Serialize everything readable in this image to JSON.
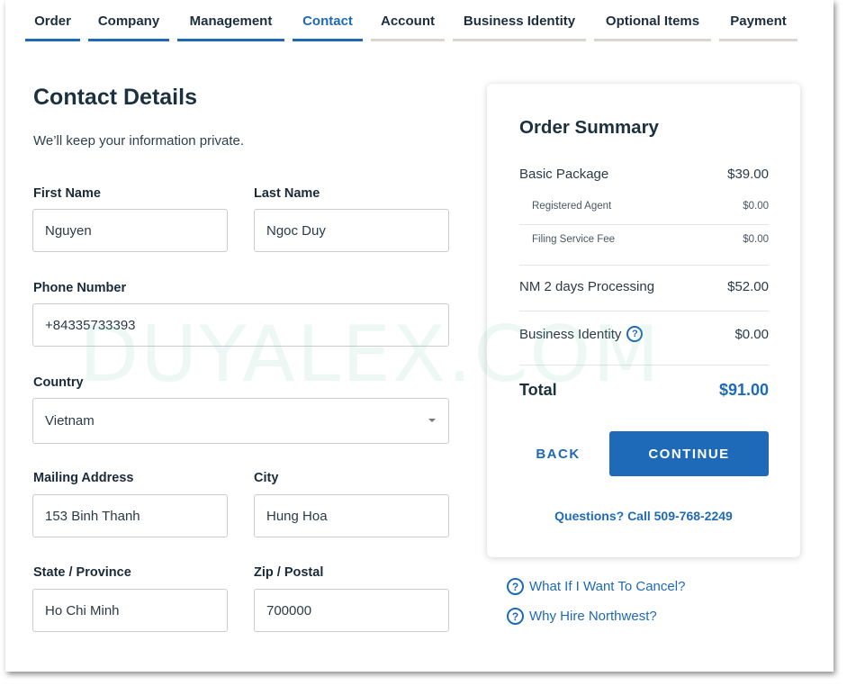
{
  "tabs": [
    {
      "label": "Order",
      "state": "done"
    },
    {
      "label": "Company",
      "state": "done"
    },
    {
      "label": "Management",
      "state": "done"
    },
    {
      "label": "Contact",
      "state": "active"
    },
    {
      "label": "Account",
      "state": "pending"
    },
    {
      "label": "Business Identity",
      "state": "pending"
    },
    {
      "label": "Optional Items",
      "state": "pending"
    },
    {
      "label": "Payment",
      "state": "pending"
    }
  ],
  "form": {
    "title": "Contact Details",
    "subtitle": "We’ll keep your information private.",
    "first_name": {
      "label": "First Name",
      "value": "Nguyen"
    },
    "last_name": {
      "label": "Last Name",
      "value": "Ngoc Duy"
    },
    "phone": {
      "label": "Phone Number",
      "value": "+84335733393"
    },
    "country": {
      "label": "Country",
      "value": "Vietnam"
    },
    "address": {
      "label": "Mailing Address",
      "value": "153 Binh Thanh"
    },
    "city": {
      "label": "City",
      "value": "Hung Hoa"
    },
    "state": {
      "label": "State / Province",
      "value": "Ho Chi Minh"
    },
    "zip": {
      "label": "Zip / Postal",
      "value": "700000"
    }
  },
  "summary": {
    "title": "Order Summary",
    "basic": {
      "label": "Basic Package",
      "amount": "$39.00"
    },
    "agent": {
      "label": "Registered Agent",
      "amount": "$0.00"
    },
    "filing": {
      "label": "Filing Service Fee",
      "amount": "$0.00"
    },
    "processing": {
      "label": "NM 2 days Processing",
      "amount": "$52.00"
    },
    "identity": {
      "label": "Business Identity",
      "amount": "$0.00"
    },
    "total": {
      "label": "Total",
      "amount": "$91.00"
    },
    "back_label": "BACK",
    "continue_label": "CONTINUE",
    "phone_text": "Questions? Call 509-768-2249"
  },
  "help_links": {
    "cancel": "What If I Want To Cancel?",
    "why": "Why Hire Northwest?"
  },
  "watermark": "DUYALEX.COM",
  "colors": {
    "accent": "#1f6ab8",
    "tab_inactive": "#d9d5d0",
    "heading": "#1b3140"
  }
}
